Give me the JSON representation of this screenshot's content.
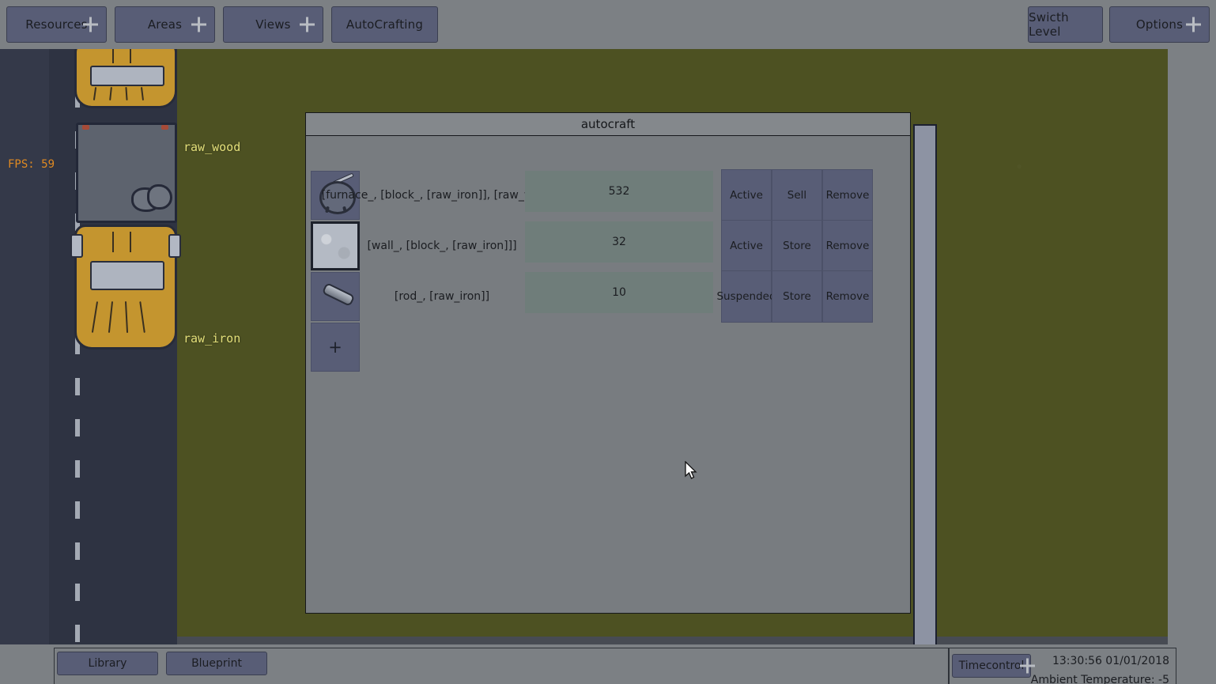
{
  "toolbar": {
    "left_buttons": [
      {
        "label": "Resources",
        "icon": "plus-icon",
        "has_plus": true
      },
      {
        "label": "Areas",
        "icon": "plus-icon",
        "has_plus": true
      },
      {
        "label": "Views",
        "icon": "plus-icon",
        "has_plus": true
      },
      {
        "label": "AutoCrafting",
        "icon": "",
        "has_plus": false
      }
    ],
    "right_buttons": [
      {
        "label": "Swicth Level",
        "icon": "",
        "has_plus": false
      },
      {
        "label": "Options",
        "icon": "plus-icon",
        "has_plus": true
      }
    ]
  },
  "hud": {
    "fps": "FPS: 59",
    "resource_labels": [
      {
        "name": "raw_wood"
      },
      {
        "name": "raw_iron"
      }
    ]
  },
  "dialog": {
    "title": "autocraft",
    "add_row_label": "+",
    "rows": [
      {
        "icon": "furnace-icon",
        "recipe": "[furnace_, [block_, [raw_iron]], [raw_wood]]",
        "quantity": "532",
        "status_label": "Active",
        "output_label": "Sell",
        "remove_label": "Remove"
      },
      {
        "icon": "wall-icon",
        "recipe": "[wall_, [block_, [raw_iron]]]",
        "quantity": "32",
        "status_label": "Active",
        "output_label": "Store",
        "remove_label": "Remove"
      },
      {
        "icon": "rod-icon",
        "recipe": "[rod_, [raw_iron]]",
        "quantity": "10",
        "status_label": "Suspended",
        "output_label": "Store",
        "remove_label": "Remove"
      }
    ]
  },
  "bottombar": {
    "library_label": "Library",
    "blueprint_label": "Blueprint",
    "timecontrol_label": "Timecontrol",
    "datetime": "13:30:56 01/01/2018",
    "ambient_temperature": "Ambient Temperature: -5"
  },
  "colors": {
    "button_face": "#585d76",
    "panel_gray": "#7c8084",
    "dialog_body": "#787c80",
    "dialog_title": "#84888c",
    "quantity_bar": "#6f7d7a",
    "field_green": "#4d5122",
    "road_dark": "#2e3342",
    "fps_orange": "#e08a22",
    "resource_yellow": "#e4e07a",
    "vehicle_yellow": "#c4952f"
  }
}
